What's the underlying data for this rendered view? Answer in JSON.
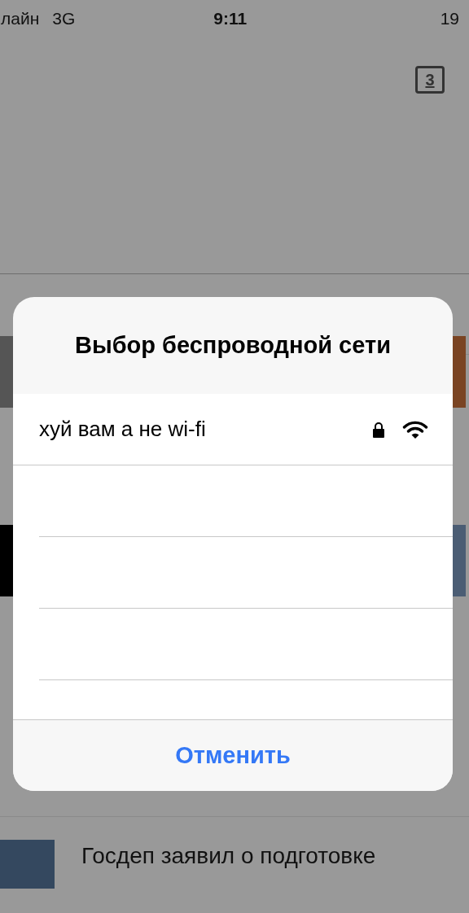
{
  "status_bar": {
    "carrier": "лайн",
    "network": "3G",
    "time": "9:11",
    "battery": "19"
  },
  "tabs_button": {
    "count": "3"
  },
  "dialog": {
    "title": "Выбор беспроводной сети",
    "networks": [
      {
        "name": "хуй вам а не wi-fi",
        "locked": true
      }
    ],
    "cancel": "Отменить"
  },
  "news": [
    {
      "headline": "Госдеп заявил о подготовке"
    }
  ]
}
